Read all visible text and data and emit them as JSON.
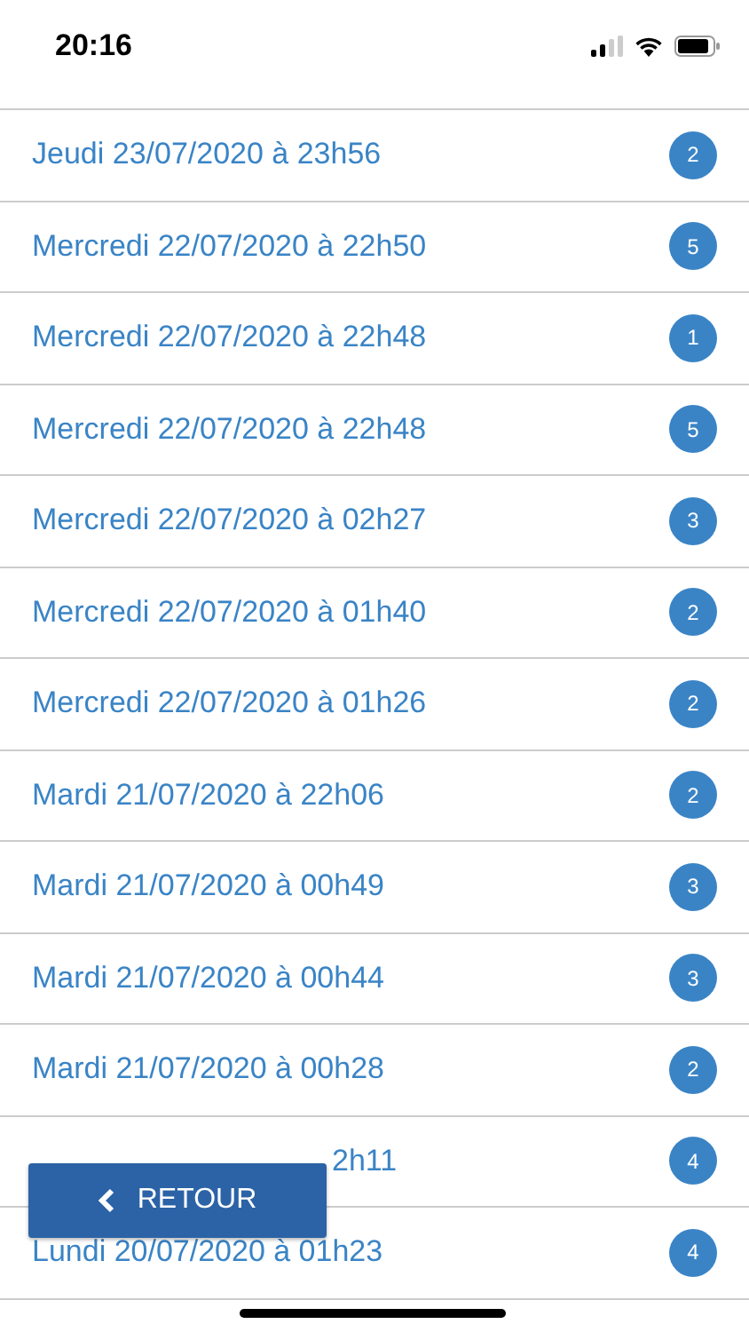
{
  "status_bar": {
    "time": "20:16"
  },
  "sessions": [
    {
      "label": "Jeudi 23/07/2020 à 23h56",
      "count": "2"
    },
    {
      "label": "Mercredi 22/07/2020 à 22h50",
      "count": "5"
    },
    {
      "label": "Mercredi 22/07/2020 à 22h48",
      "count": "1"
    },
    {
      "label": "Mercredi 22/07/2020 à 22h48",
      "count": "5"
    },
    {
      "label": "Mercredi 22/07/2020 à 02h27",
      "count": "3"
    },
    {
      "label": "Mercredi 22/07/2020 à 01h40",
      "count": "2"
    },
    {
      "label": "Mercredi 22/07/2020 à 01h26",
      "count": "2"
    },
    {
      "label": "Mardi 21/07/2020 à 22h06",
      "count": "2"
    },
    {
      "label": "Mardi 21/07/2020 à 00h49",
      "count": "3"
    },
    {
      "label": "Mardi 21/07/2020 à 00h44",
      "count": "3"
    },
    {
      "label": "Mardi 21/07/2020 à 00h28",
      "count": "2"
    },
    {
      "label": "2h11",
      "count": "4",
      "kind": "covered"
    },
    {
      "label": "Lundi 20/07/2020 à 01h23",
      "count": "4"
    }
  ],
  "back_button": {
    "label": "RETOUR"
  }
}
